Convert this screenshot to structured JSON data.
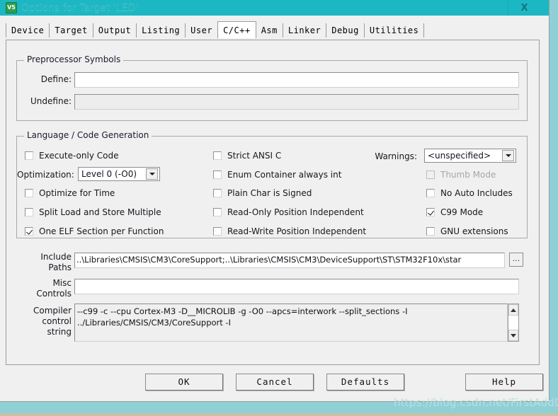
{
  "window": {
    "title": "Options for Target 'LED'",
    "icon": "uvision-logo-icon",
    "close_label": "X"
  },
  "tabs": [
    {
      "label": "Device",
      "active": false
    },
    {
      "label": "Target",
      "active": false
    },
    {
      "label": "Output",
      "active": false
    },
    {
      "label": "Listing",
      "active": false
    },
    {
      "label": "User",
      "active": false
    },
    {
      "label": "C/C++",
      "active": true
    },
    {
      "label": "Asm",
      "active": false
    },
    {
      "label": "Linker",
      "active": false
    },
    {
      "label": "Debug",
      "active": false
    },
    {
      "label": "Utilities",
      "active": false
    }
  ],
  "preprocessor": {
    "group_title": "Preprocessor Symbols",
    "define_label": "Define:",
    "define_value": "",
    "define_placeholder": "",
    "undefine_label": "Undefine:",
    "undefine_value": "",
    "undefine_placeholder": ""
  },
  "language": {
    "group_title": "Language / Code Generation",
    "col1": [
      {
        "label": "Execute-only Code",
        "checked": false,
        "enabled": true
      },
      {
        "label": "Optimize for Time",
        "checked": false,
        "enabled": true
      },
      {
        "label": "Split Load and Store Multiple",
        "checked": false,
        "enabled": true
      },
      {
        "label": "One ELF Section per Function",
        "checked": true,
        "enabled": true
      }
    ],
    "optimization_label": "Optimization:",
    "optimization_value": "Level 0 (-O0)",
    "col2": [
      {
        "label": "Strict ANSI C",
        "checked": false,
        "enabled": true
      },
      {
        "label": "Enum Container always int",
        "checked": false,
        "enabled": true
      },
      {
        "label": "Plain Char is Signed",
        "checked": false,
        "enabled": true
      },
      {
        "label": "Read-Only Position Independent",
        "checked": false,
        "enabled": true
      },
      {
        "label": "Read-Write Position Independent",
        "checked": false,
        "enabled": true
      }
    ],
    "warnings_label": "Warnings:",
    "warnings_value": "<unspecified>",
    "col3": [
      {
        "label": "Thumb Mode",
        "checked": false,
        "enabled": false
      },
      {
        "label": "No Auto Includes",
        "checked": false,
        "enabled": true
      },
      {
        "label": "C99 Mode",
        "checked": true,
        "enabled": true
      },
      {
        "label": "GNU extensions",
        "checked": false,
        "enabled": true
      }
    ]
  },
  "fields": {
    "include_paths_label": "Include\nPaths",
    "include_paths_value": "..\\Libraries\\CMSIS\\CM3\\CoreSupport;..\\Libraries\\CMSIS\\CM3\\DeviceSupport\\ST\\STM32F10x\\star",
    "include_browse_label": "...",
    "misc_controls_label": "Misc\nControls",
    "misc_controls_value": "",
    "compiler_string_label": "Compiler\ncontrol\nstring",
    "compiler_string_value": "--c99 -c --cpu Cortex-M3 -D__MICROLIB -g -O0 --apcs=interwork --split_sections -I\n../Libraries/CMSIS/CM3/CoreSupport -I"
  },
  "buttons": {
    "ok": "OK",
    "cancel": "Cancel",
    "defaults": "Defaults",
    "help": "Help"
  },
  "watermark": "https://blog.csdn.net/FirstAddDuke",
  "colors": {
    "titlebar_teal": "#1BB8C4",
    "desktop_teal": "#8FD0D6",
    "dialog_bg": "#F0F0F0",
    "field_white": "#FFFFFF",
    "field_disabled": "#EDEDED"
  }
}
